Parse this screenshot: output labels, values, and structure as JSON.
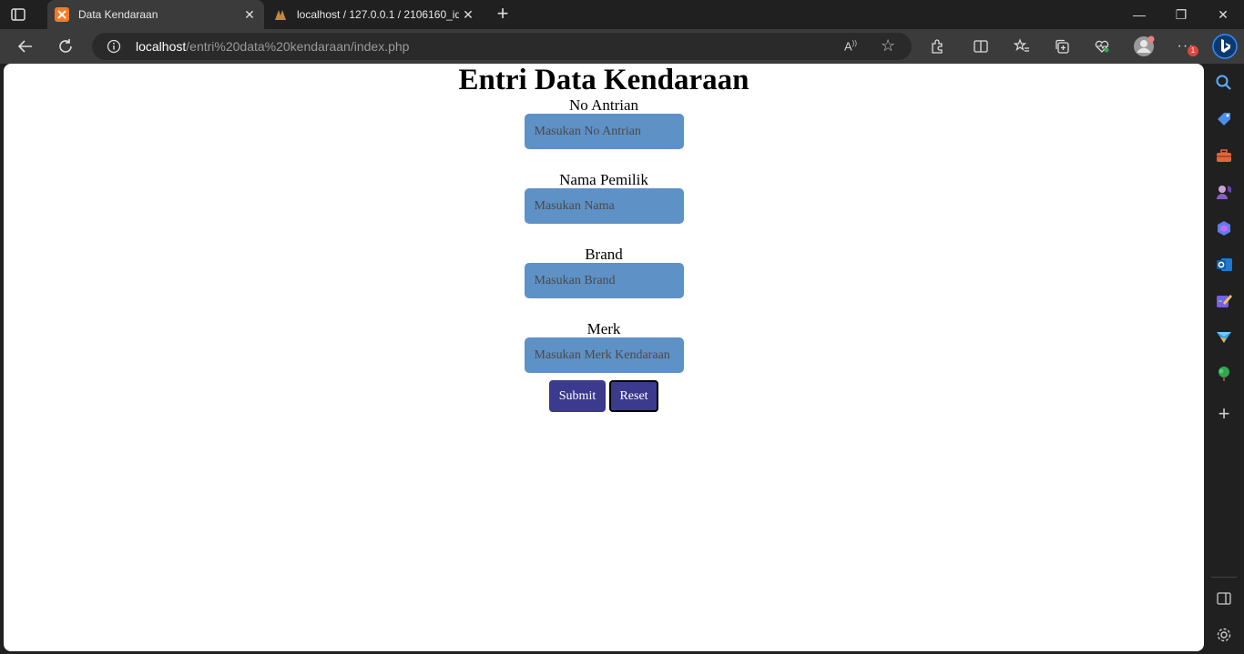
{
  "browser": {
    "tabs": [
      {
        "title": "Data Kendaraan",
        "active": true
      },
      {
        "title": "localhost / 127.0.0.1 / 2106160_id…",
        "active": false
      }
    ],
    "url_host": "localhost",
    "url_path": "/entri%20data%20kendaraan/index.php",
    "notification_badge": "1"
  },
  "page": {
    "title": "Entri Data Kendaraan",
    "fields": [
      {
        "label": "No Antrian",
        "placeholder": "Masukan No Antrian"
      },
      {
        "label": "Nama Pemilik",
        "placeholder": "Masukan Nama"
      },
      {
        "label": "Brand",
        "placeholder": "Masukan Brand"
      },
      {
        "label": "Merk",
        "placeholder": "Masukan Merk Kendaraan"
      }
    ],
    "submit_label": "Submit",
    "reset_label": "Reset"
  },
  "colors": {
    "input_bg": "#5e91c6",
    "button_bg": "#3b3a8f",
    "tab_active": "#3b3b3b",
    "chrome_bg": "#202020"
  },
  "icons": {
    "sidebar": [
      "search-icon",
      "tag-icon",
      "toolbox-icon",
      "games-icon",
      "copilot-icon",
      "outlook-icon",
      "designer-icon",
      "send-icon",
      "tree-icon",
      "add-icon",
      "sidebar-toggle-icon",
      "settings-icon"
    ]
  }
}
